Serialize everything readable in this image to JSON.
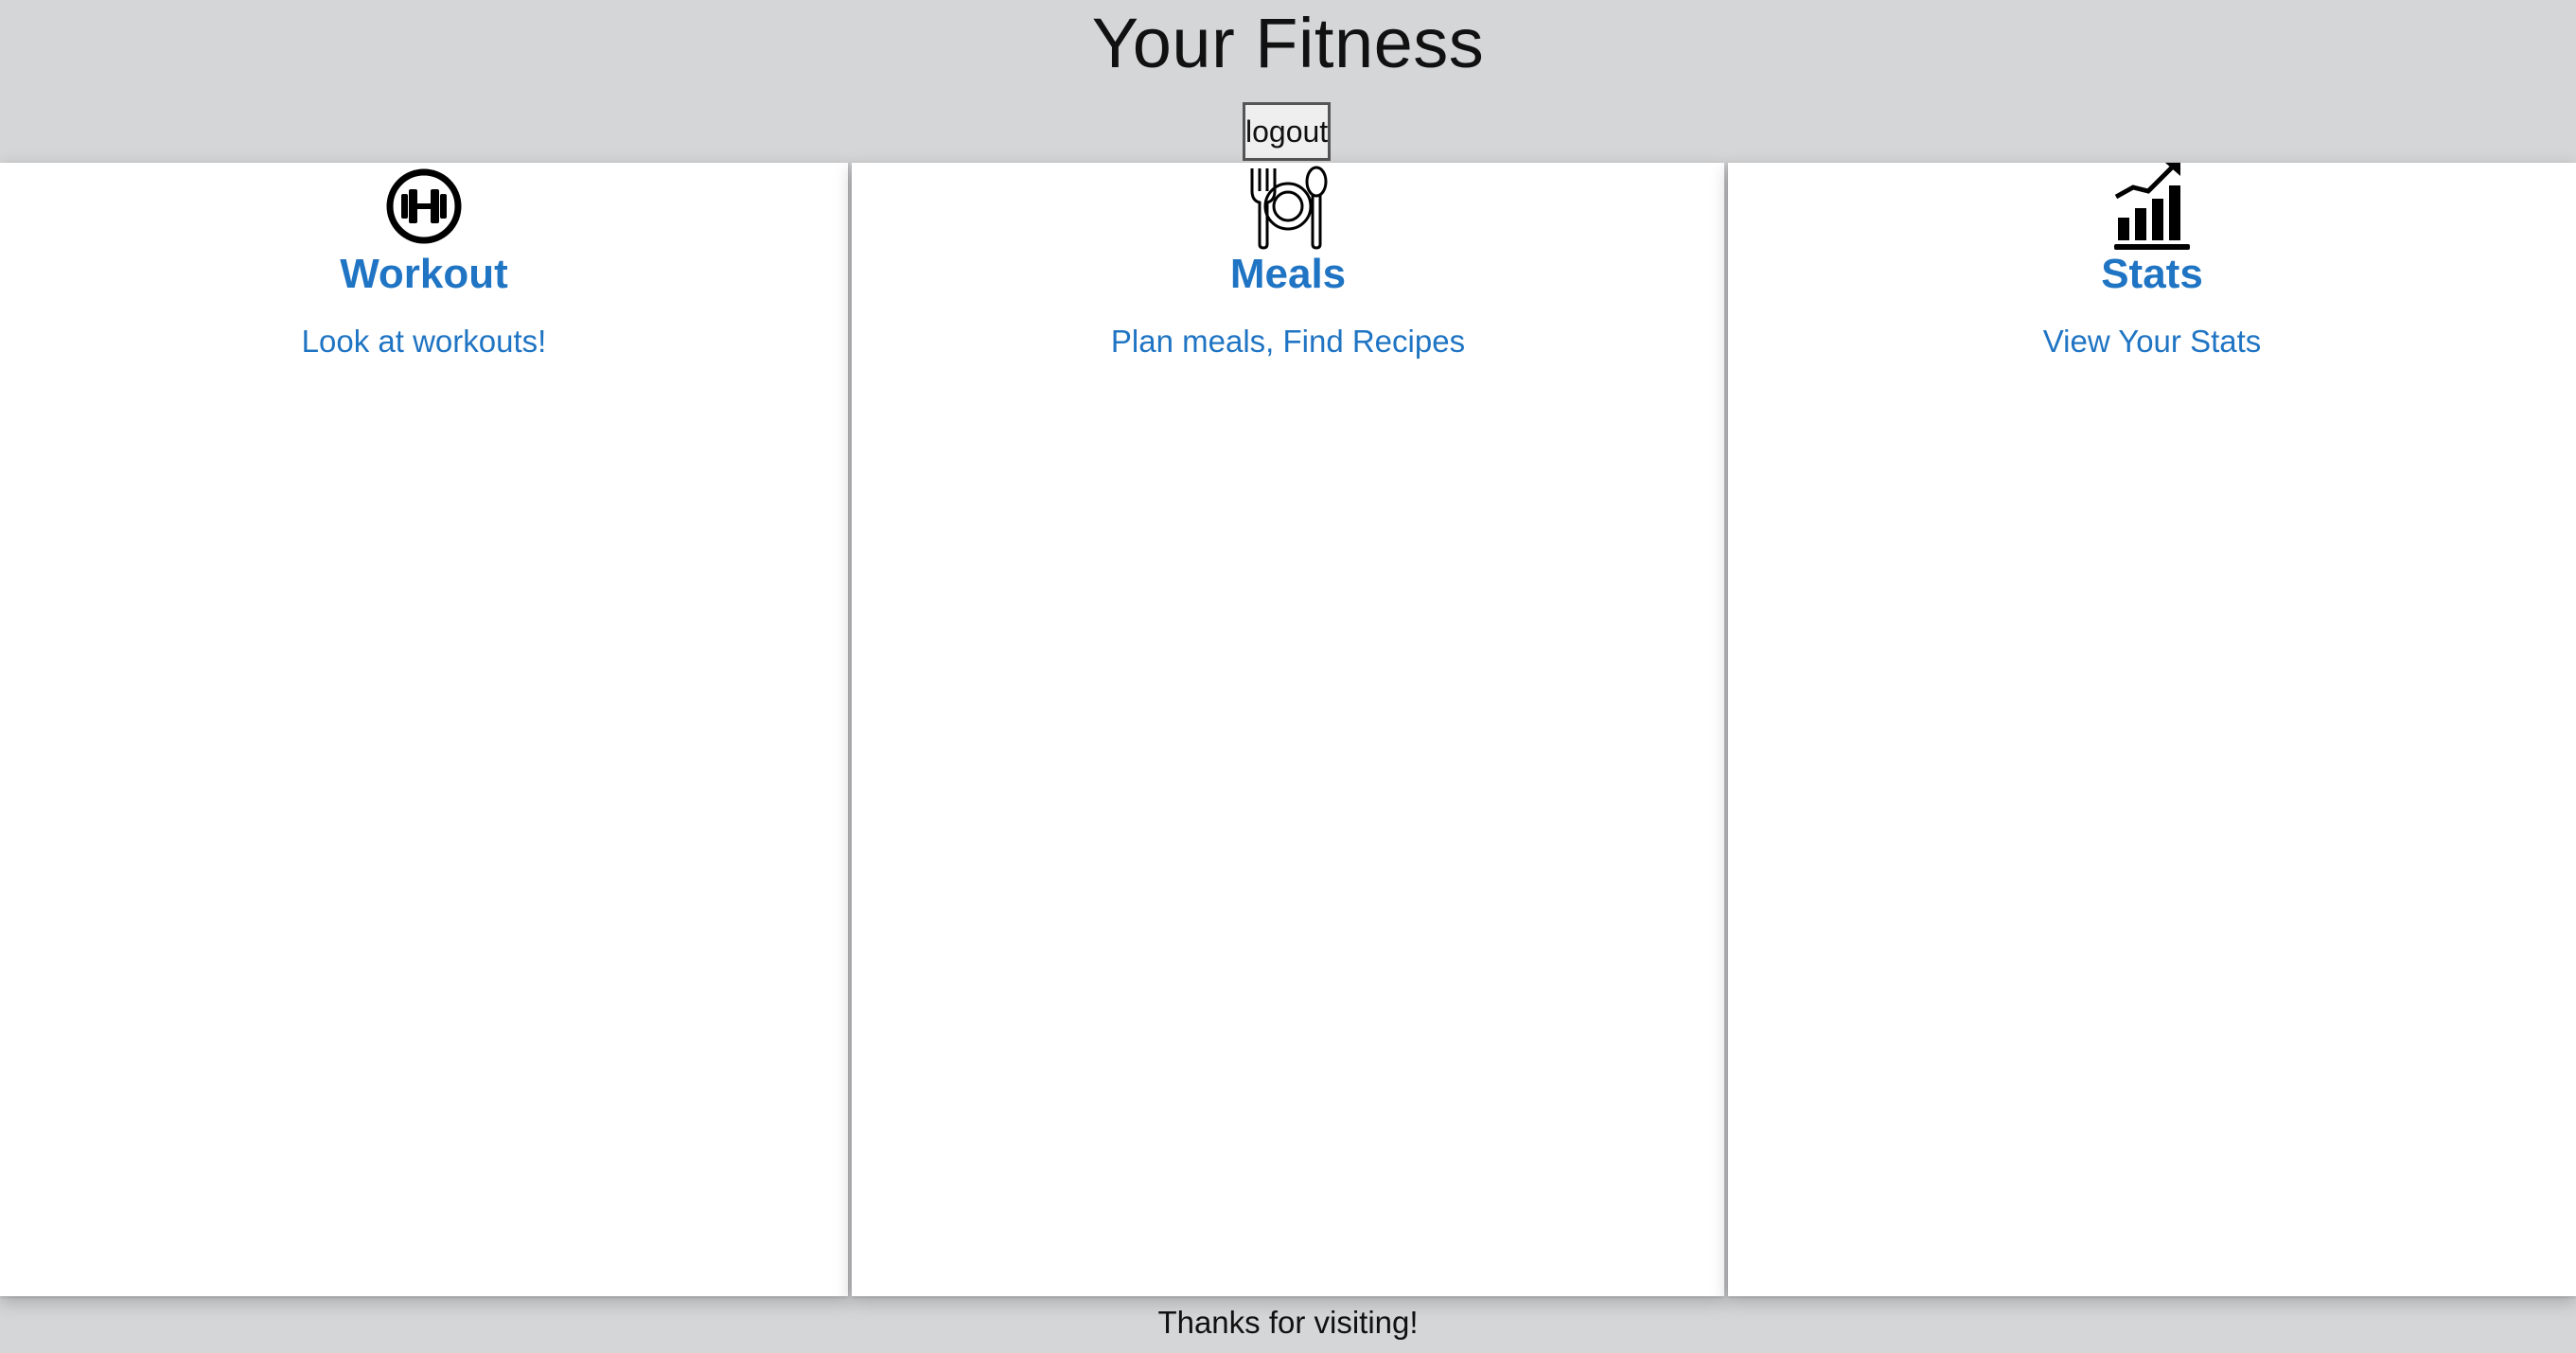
{
  "header": {
    "title": "Your Fitness",
    "logout_label": "logout"
  },
  "cards": [
    {
      "icon": "dumbbell-icon",
      "title": "Workout",
      "subtitle": "Look at workouts!"
    },
    {
      "icon": "plate-cutlery-icon",
      "title": "Meals",
      "subtitle": "Plan meals, Find Recipes"
    },
    {
      "icon": "bar-chart-trend-icon",
      "title": "Stats",
      "subtitle": "View Your Stats"
    }
  ],
  "footer": {
    "text": "Thanks for visiting!"
  },
  "colors": {
    "background": "#d5d6d8",
    "card": "#ffffff",
    "accent": "#1f74c3",
    "text": "#111111"
  }
}
